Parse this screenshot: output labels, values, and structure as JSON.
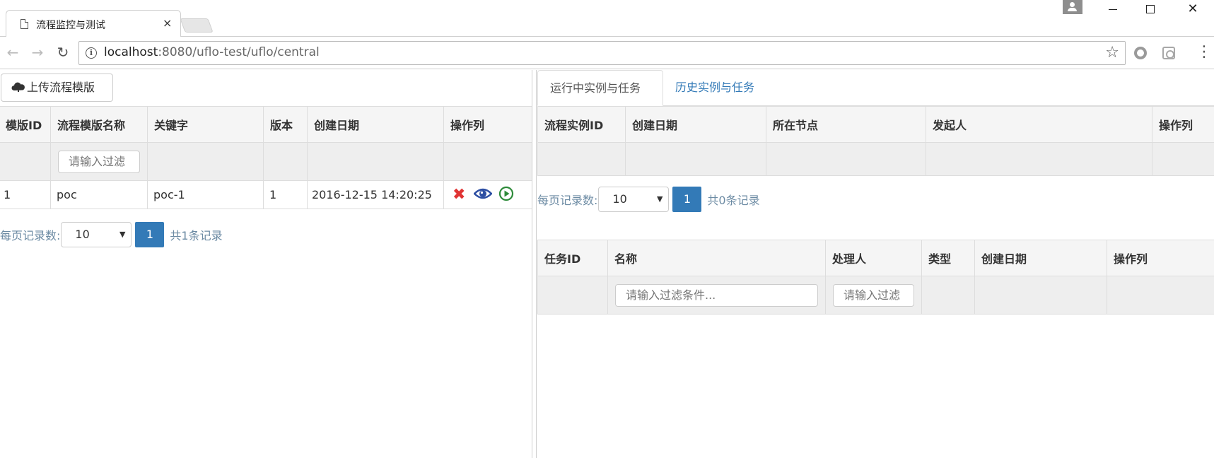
{
  "browser": {
    "tab_title": "流程监控与测试",
    "tab_close": "×",
    "url_host": "localhost",
    "url_path": ":8080/uflo-test/uflo/central",
    "back": "←",
    "forward": "→",
    "reload": "↻",
    "star": "☆",
    "menu": "⋮",
    "info": "i"
  },
  "left": {
    "upload_button": "上传流程模版",
    "table": {
      "headers": [
        "模版ID",
        "流程模版名称",
        "关键字",
        "版本",
        "创建日期",
        "操作列"
      ],
      "filter_placeholder": "请输入过滤",
      "rows": [
        {
          "id": "1",
          "name": "poc",
          "key": "poc-1",
          "version": "1",
          "created": "2016-12-15 14:20:25"
        }
      ]
    },
    "pager": {
      "label": "每页记录数:",
      "page_size": "10",
      "page": "1",
      "total": "共1条记录"
    }
  },
  "right": {
    "tabs": [
      "运行中实例与任务",
      "历史实例与任务"
    ],
    "instance_table": {
      "headers": [
        "流程实例ID",
        "创建日期",
        "所在节点",
        "发起人",
        "操作列"
      ]
    },
    "pager": {
      "label": "每页记录数:",
      "page_size": "10",
      "page": "1",
      "total": "共0条记录"
    },
    "task_table": {
      "headers": [
        "任务ID",
        "名称",
        "处理人",
        "类型",
        "创建日期",
        "操作列"
      ],
      "filter_name_placeholder": "请输入过滤条件...",
      "filter_assignee_placeholder": "请输入过滤"
    }
  },
  "colors": {
    "accent": "#337ab7",
    "delete": "#e03434",
    "view": "#2d4fa3",
    "start": "#2e8b3a"
  }
}
